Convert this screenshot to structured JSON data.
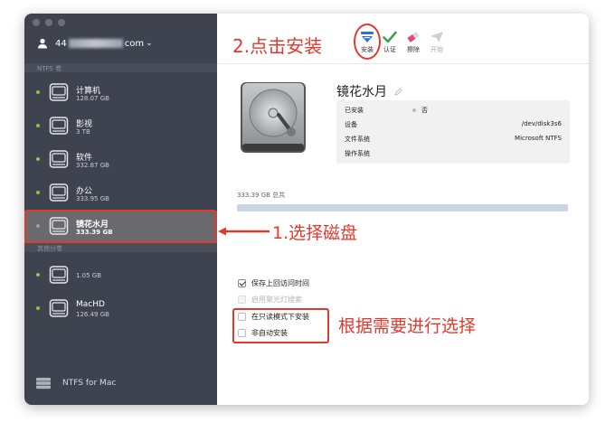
{
  "window": {
    "traffic_lights": [
      "close",
      "minimize",
      "zoom"
    ]
  },
  "sidebar": {
    "account": {
      "prefix": "44",
      "suffix": "com",
      "chevron": "⌄"
    },
    "section_ntfs": "NTFS 卷",
    "section_other": "其他分卷",
    "ntfs_disks": [
      {
        "name": "计算机",
        "size": "128.07 GB",
        "status_color": "#8bc34a"
      },
      {
        "name": "影视",
        "size": "3 TB",
        "status_color": "#8bc34a"
      },
      {
        "name": "软件",
        "size": "332.87 GB",
        "status_color": "#8bc34a"
      },
      {
        "name": "办公",
        "size": "333.95 GB",
        "status_color": "#8bc34a"
      },
      {
        "name": "镜花水月",
        "size": "333.39 GB",
        "status_color": "#9a9da5",
        "selected": true
      }
    ],
    "other_disks": [
      {
        "name": "",
        "size": "1.05 GB",
        "status_color": "#8bc34a"
      },
      {
        "name": "MacHD",
        "size": "126.49 GB",
        "status_color": "#8bc34a"
      }
    ],
    "brand": "NTFS for Mac"
  },
  "toolbar": {
    "buttons": [
      {
        "label": "安装",
        "icon": "mount-icon",
        "enabled": true
      },
      {
        "label": "认证",
        "icon": "check-icon",
        "enabled": true
      },
      {
        "label": "擦除",
        "icon": "eraser-icon",
        "enabled": true
      },
      {
        "label": "开始",
        "icon": "launch-icon",
        "enabled": false
      }
    ]
  },
  "volume": {
    "title": "镜花水月",
    "info": [
      {
        "key": "已安装",
        "value": "否"
      },
      {
        "key": "设备",
        "value": "/dev/disk3s6"
      },
      {
        "key": "文件系统",
        "value": "Microsoft NTFS"
      },
      {
        "key": "操作系统",
        "value": ""
      }
    ],
    "total": "333.39 GB 总共",
    "usage_fraction": 1.0
  },
  "options": [
    {
      "label": "保存上回访问时间",
      "checked": true,
      "enabled": true
    },
    {
      "label": "启用聚光灯搜索",
      "checked": false,
      "enabled": false
    },
    {
      "label": "在只读模式下安装",
      "checked": false,
      "enabled": true
    },
    {
      "label": "非自动安装",
      "checked": false,
      "enabled": true
    }
  ],
  "annotations": {
    "step1": "1.选择磁盘",
    "step2": "2.点击安装",
    "step3": "根据需要进行选择"
  },
  "colors": {
    "annotation": "#e03a2f",
    "sidebar_bg": "#3f4350",
    "selected_row": "#6a6a6c",
    "accent_blue": "#2f6fd6",
    "check_green": "#3aa34a"
  }
}
